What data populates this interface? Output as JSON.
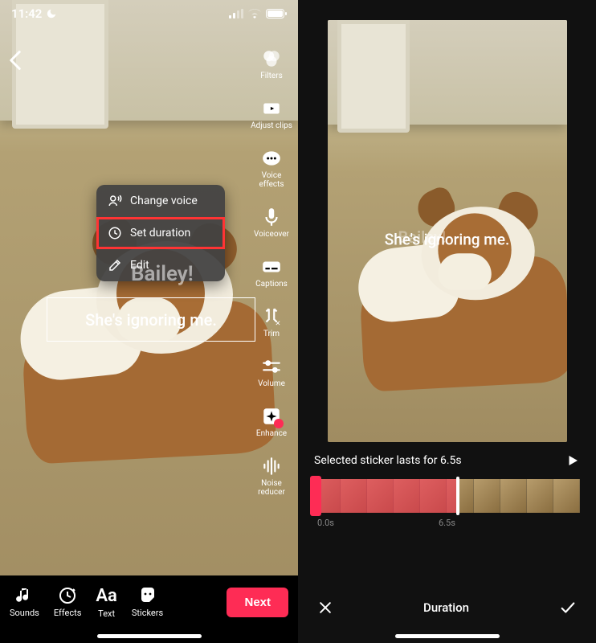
{
  "statusbar": {
    "time": "11:42"
  },
  "back_icon": "‹",
  "edit_tools": [
    {
      "name": "filters",
      "label": "Filters"
    },
    {
      "name": "adjust-clips",
      "label": "Adjust clips"
    },
    {
      "name": "voice-effects",
      "label": "Voice effects"
    },
    {
      "name": "voiceover",
      "label": "Voiceover"
    },
    {
      "name": "captions",
      "label": "Captions"
    },
    {
      "name": "trim",
      "label": "Trim"
    },
    {
      "name": "volume",
      "label": "Volume"
    },
    {
      "name": "enhance",
      "label": "Enhance"
    },
    {
      "name": "noise-reducer",
      "label": "Noise reducer"
    }
  ],
  "context_menu": {
    "items": [
      {
        "name": "change-voice",
        "label": "Change voice"
      },
      {
        "name": "set-duration",
        "label": "Set duration",
        "highlighted": true
      },
      {
        "name": "edit",
        "label": "Edit"
      }
    ]
  },
  "overlay_text_faded": "Bailey!",
  "overlay_text_active": "She's ignoring me.",
  "bottom_tools": [
    {
      "name": "sounds",
      "label": "Sounds"
    },
    {
      "name": "effects",
      "label": "Effects"
    },
    {
      "name": "text",
      "label": "Text",
      "glyph": "Aa"
    },
    {
      "name": "stickers",
      "label": "Stickers"
    }
  ],
  "next_button": "Next",
  "right": {
    "preview_text": "She's ignoring me.",
    "preview_faded": "Bailey!",
    "duration_message": "Selected sticker lasts for 6.5s",
    "timeline": {
      "start": "0.0s",
      "end": "6.5s"
    },
    "bottom_title": "Duration"
  }
}
